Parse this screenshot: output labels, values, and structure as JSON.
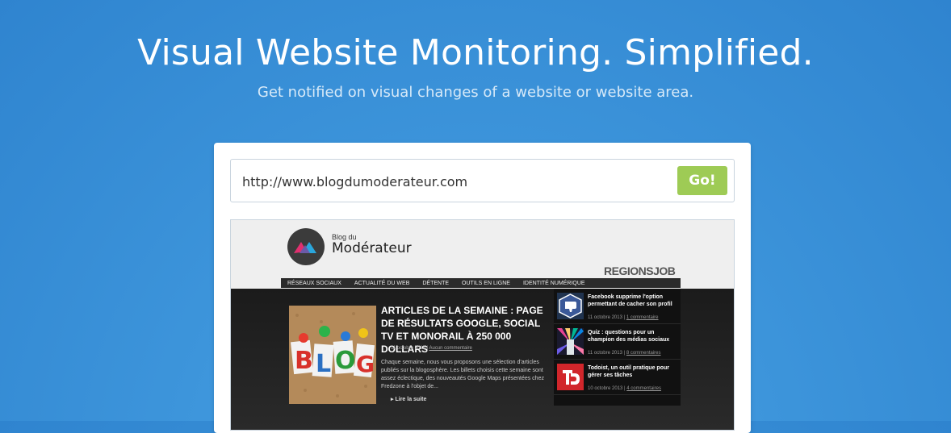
{
  "hero": {
    "title": "Visual Website Monitoring. Simplified.",
    "subtitle": "Get notified on visual changes of a website or website area."
  },
  "form": {
    "url_value": "http://www.blogdumoderateur.com",
    "go_label": "Go!"
  },
  "preview": {
    "logo_small": "Blog du",
    "logo_big": "Modérateur",
    "partner_logo": "REGIONSJOB",
    "nav": [
      "RÉSEAUX SOCIAUX",
      "ACTUALITÉ DU WEB",
      "DÉTENTE",
      "OUTILS EN LIGNE",
      "IDENTITÉ NUMÉRIQUE"
    ],
    "featured": {
      "title": "ARTICLES DE LA SEMAINE : PAGE DE RÉSULTATS GOOGLE, SOCIAL TV ET MONORAIL À 250 000 DOLLARS",
      "date": "11 octobre 2013 |",
      "comments": "Aucun commentaire",
      "excerpt": "Chaque semaine, nous vous proposons une sélection d'articles publiés sur la blogosphère. Les billets choisis cette semaine sont assez éclectique, des nouveautés Google Maps présentées chez Fredzone à l'objet de...",
      "read_more": "Lire la suite",
      "image_text": "BLOG"
    },
    "side_items": [
      {
        "title": "Facebook supprime l'option permettant de cacher son profil",
        "date": "11 octobre 2013 |",
        "comments": "1 commentaire"
      },
      {
        "title": "Quiz : questions pour un champion des médias sociaux",
        "date": "11 octobre 2013 |",
        "comments": "8 commentaires"
      },
      {
        "title": "Todoist, un outil pratique pour gérer ses tâches",
        "date": "10 octobre 2013 |",
        "comments": "4 commentaires"
      }
    ]
  }
}
